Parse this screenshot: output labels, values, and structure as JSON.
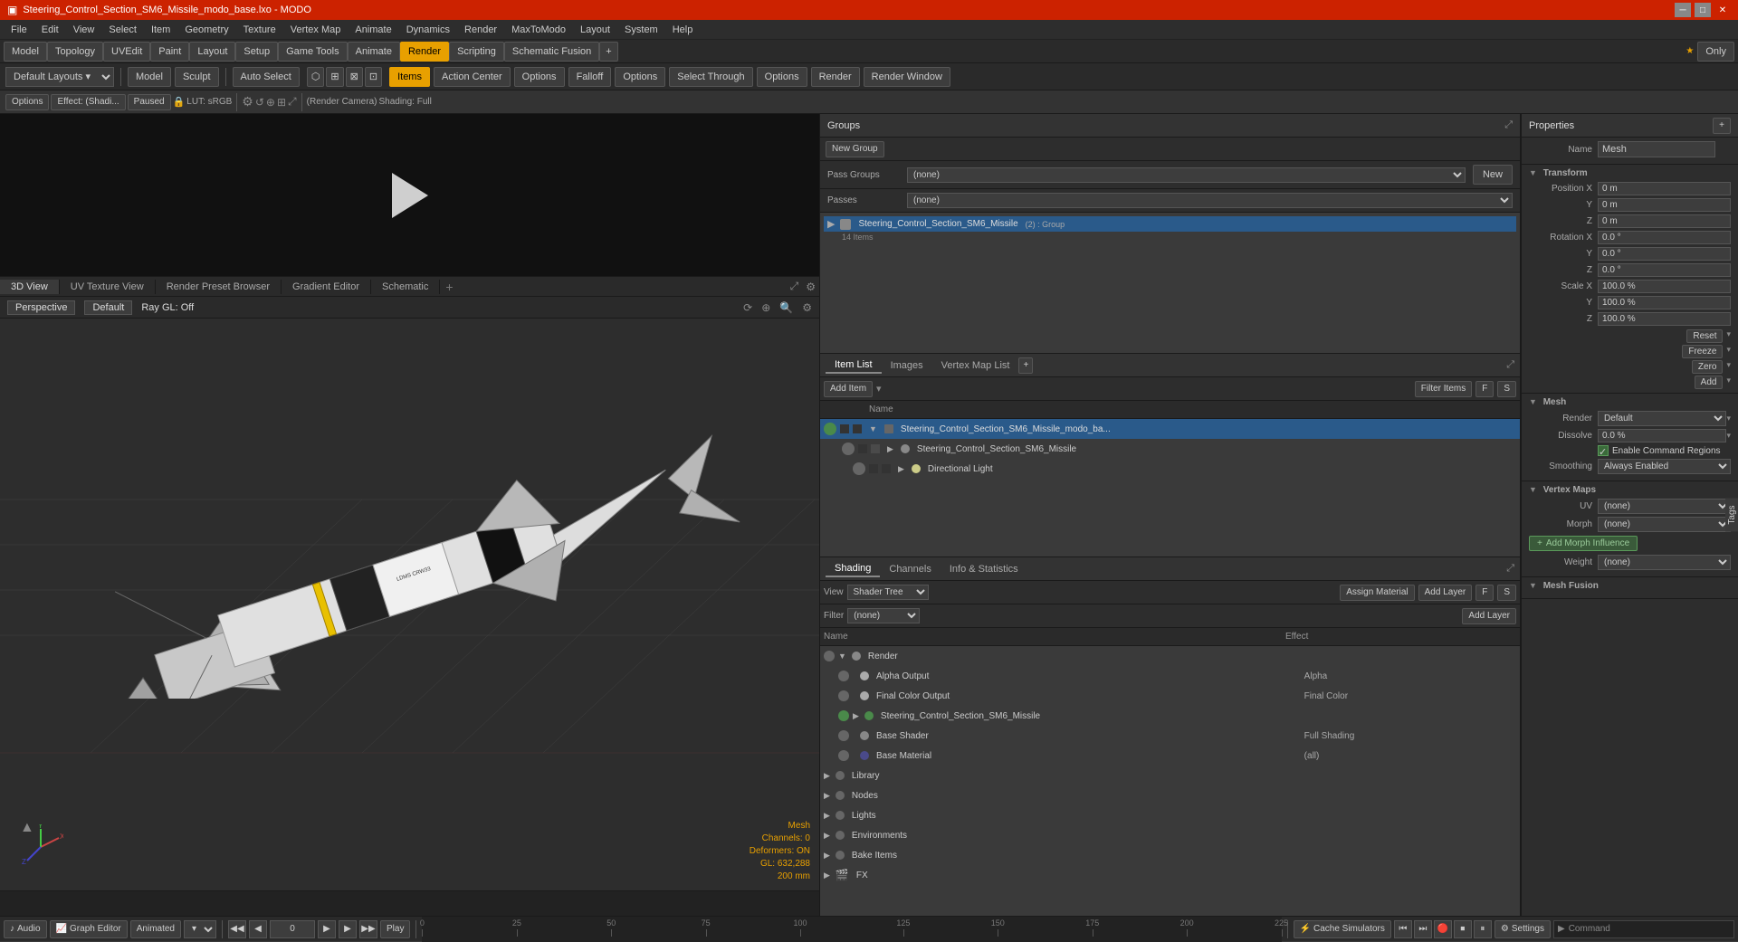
{
  "titleBar": {
    "title": "Steering_Control_Section_SM6_Missile_modo_base.lxo - MODO",
    "minBtn": "─",
    "maxBtn": "□",
    "closeBtn": "✕"
  },
  "menuBar": {
    "items": [
      "File",
      "Edit",
      "View",
      "Select",
      "Item",
      "Geometry",
      "Texture",
      "Vertex Map",
      "Animate",
      "Dynamics",
      "Render",
      "MaxToModo",
      "Layout",
      "System",
      "Help"
    ]
  },
  "toolbar1": {
    "layout_dropdown": "Default Layouts",
    "modes": [
      "Model",
      "Sculpt"
    ],
    "autoSelect": "Auto Select",
    "tools": [
      "Items",
      "Action Center",
      "Options",
      "Falloff",
      "Options",
      "Select Through",
      "Options",
      "Render",
      "Render Window"
    ]
  },
  "toolbar2": {
    "options": "Options",
    "effect": "Effect: (Shadi...",
    "paused": "Paused",
    "lut": "LUT: sRGB",
    "renderCamera": "(Render Camera)",
    "shading": "Shading: Full"
  },
  "modeBar": {
    "tabs": [
      "Model",
      "Topology",
      "UVEdit",
      "Paint",
      "Layout",
      "Setup",
      "Game Tools",
      "Animate",
      "Render",
      "Scripting",
      "Schematic Fusion"
    ],
    "active": "Render",
    "onlyBtn": "Only",
    "addBtn": "+"
  },
  "viewportTabs": {
    "tabs": [
      "3D View",
      "UV Texture View",
      "Render Preset Browser",
      "Gradient Editor",
      "Schematic"
    ],
    "active": "3D View",
    "addTab": "+"
  },
  "viewport3d": {
    "perspective": "Perspective",
    "default": "Default",
    "rayGL": "Ray GL: Off",
    "meshLabel": "Mesh",
    "channels": "Channels: 0",
    "deformers": "Deformers: ON",
    "gl": "GL: 632,288",
    "size": "200 mm"
  },
  "groupsPanel": {
    "title": "Groups",
    "newGroupBtn": "New Group",
    "passGroupsLabel": "Pass Groups",
    "passGroupsValue": "(none)",
    "passesLabel": "Passes",
    "passesValue": "(none)",
    "newBtn": "New"
  },
  "groupsTree": {
    "items": [
      {
        "name": "Steering_Control_Section_SM6_Missile",
        "suffix": "(2) : Group",
        "count": "14 Items",
        "expanded": true
      }
    ]
  },
  "itemsPanel": {
    "tabs": [
      "Item List",
      "Images",
      "Vertex Map List"
    ],
    "activeTab": "Item List",
    "addItemBtn": "Add Item",
    "filterItemsBtn": "Filter Items",
    "addBtn": "+",
    "columns": [
      "Name"
    ],
    "items": [
      {
        "name": "Steering_Control_Section_SM6_Missile_modo_ba...",
        "indent": 0,
        "expanded": true,
        "type": "mesh"
      },
      {
        "name": "Steering_Control_Section_SM6_Missile",
        "indent": 1,
        "expanded": false,
        "type": "group"
      },
      {
        "name": "Directional Light",
        "indent": 2,
        "expanded": false,
        "type": "light"
      }
    ]
  },
  "shadingPanel": {
    "title": "Shading",
    "tabs": [
      "Channels",
      "Info & Statistics"
    ],
    "activeTab": "Shading",
    "viewLabel": "View",
    "viewValue": "Shader Tree",
    "assignMaterialBtn": "Assign Material",
    "addLayerBtn": "Add Layer",
    "filterLabel": "Filter",
    "filterValue": "(none)",
    "columns": [
      "Name",
      "Effect"
    ],
    "rows": [
      {
        "name": "Render",
        "effect": "",
        "indent": 0,
        "dot": "#888",
        "expanded": true
      },
      {
        "name": "Alpha Output",
        "effect": "Alpha",
        "indent": 1,
        "dot": "#aaa"
      },
      {
        "name": "Final Color Output",
        "effect": "Final Color",
        "indent": 1,
        "dot": "#aaa"
      },
      {
        "name": "Steering_Control_Section_SM6_Missile",
        "effect": "",
        "indent": 1,
        "dot": "#4a8a4a",
        "expanded": false
      },
      {
        "name": "Base Shader",
        "effect": "Full Shading",
        "indent": 1,
        "dot": "#888"
      },
      {
        "name": "Base Material",
        "effect": "(all)",
        "indent": 1,
        "dot": "#4a4a8a"
      },
      {
        "name": "Library",
        "effect": "",
        "indent": 0,
        "dot": "#888",
        "isFolder": true
      },
      {
        "name": "Nodes",
        "effect": "",
        "indent": 0,
        "dot": "#888",
        "isFolder": true
      },
      {
        "name": "Lights",
        "effect": "",
        "indent": 0,
        "dot": "#888",
        "isFolder": true
      },
      {
        "name": "Environments",
        "effect": "",
        "indent": 0,
        "dot": "#888",
        "isFolder": true
      },
      {
        "name": "Bake Items",
        "effect": "",
        "indent": 0,
        "dot": "#888",
        "isFolder": true
      },
      {
        "name": "FX",
        "effect": "",
        "indent": 0,
        "dot": "#888",
        "isFolder": true
      }
    ]
  },
  "propertiesPanel": {
    "title": "Properties",
    "addBtn": "+",
    "nameLabel": "Name",
    "nameValue": "Mesh",
    "transformSection": "Transform",
    "positionX": "0 m",
    "positionY": "0 m",
    "positionZ": "0 m",
    "rotationX": "0.0 °",
    "rotationY": "0.0 °",
    "rotationZ": "0.0 °",
    "scaleX": "100.0 %",
    "scaleY": "100.0 %",
    "scaleZ": "100.0 %",
    "resetBtn": "Reset",
    "freezeBtn": "Freeze",
    "zeroBtn": "Zero",
    "addTransformBtn": "Add",
    "meshSection": "Mesh",
    "renderLabel": "Render",
    "renderValue": "Default",
    "dissolveLabel": "Dissolve",
    "dissolveValue": "0.0 %",
    "enableCmdRegions": "Enable Command Regions",
    "smoothingLabel": "Smoothing",
    "smoothingValue": "Always Enabled",
    "vertexMapsSection": "Vertex Maps",
    "uvLabel": "UV",
    "uvValue": "(none)",
    "morphLabel": "Morph",
    "morphValue": "(none)",
    "addMorphBtn": "Add Morph Influence",
    "weightLabel": "Weight",
    "weightValue": "(none)",
    "meshFusionSection": "Mesh Fusion",
    "rightSideTab": "Tags"
  },
  "bottomBar": {
    "audioBtn": "Audio",
    "graphEditorBtn": "Graph Editor",
    "animatedBtn": "Animated",
    "prevKeyBtn": "◀◀",
    "prevFrameBtn": "◀",
    "frameValue": "0",
    "playBtn": "▶",
    "nextFrameBtn": "▶",
    "nextKeyBtn": "▶▶",
    "playLabelBtn": "Play",
    "cacheBtn": "Cache Simulators",
    "settingsBtn": "Settings"
  },
  "timelineLabels": [
    "0",
    "25",
    "50",
    "75",
    "100",
    "125",
    "150",
    "175",
    "200",
    "225"
  ],
  "timelinePos": [
    "0",
    "25",
    "50",
    "75",
    "100",
    "125",
    "150",
    "175",
    "200",
    "225"
  ],
  "commandBar": {
    "label": "Command"
  }
}
